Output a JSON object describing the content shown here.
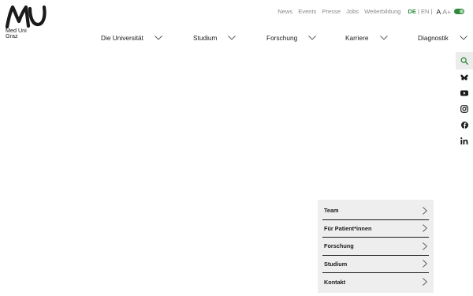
{
  "logo": {
    "name": "MU logo",
    "lines": [
      "Med Uni",
      "Graz"
    ]
  },
  "utility_nav": {
    "links": [
      "News",
      "Events",
      "Presse",
      "Jobs",
      "Weiterbildung"
    ],
    "lang_active": "DE",
    "lang_separator": "|",
    "lang_other": "EN",
    "font_normal": "A",
    "font_larger": "A+"
  },
  "main_nav": {
    "items": [
      "Die Universität",
      "Studium",
      "Forschung",
      "Karriere",
      "Diagnostik"
    ]
  },
  "social": {
    "icons": [
      "search-icon",
      "bluesky-icon",
      "youtube-icon",
      "instagram-icon",
      "facebook-icon",
      "linkedin-icon"
    ]
  },
  "side_panel": {
    "items": [
      "Team",
      "Für Patient*innen",
      "Forschung",
      "Studium",
      "Kontakt"
    ]
  },
  "colors": {
    "accent_green": "#2e8b3e",
    "panel_bg": "#eeeeee",
    "text": "#1a1a1a",
    "muted": "#8a8a8a"
  }
}
